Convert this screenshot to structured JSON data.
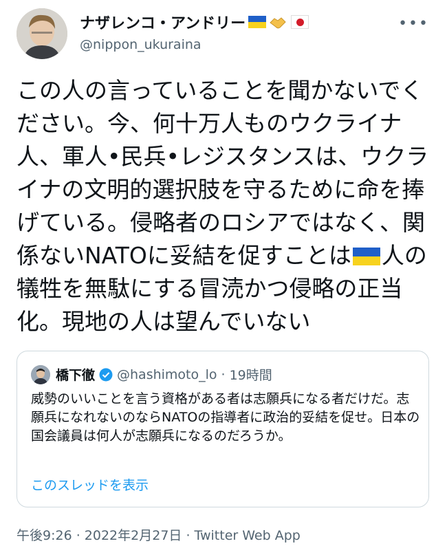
{
  "tweet": {
    "author": {
      "name": "ナザレンコ・アンドリー",
      "handle": "@nippon_ukuraina",
      "name_emojis": [
        "ukraine-flag",
        "handshake",
        "japan-flag"
      ]
    },
    "text_parts": {
      "part1": "この人の言っていることを聞かないでください。今、何十万人ものウクライナ人、軍人•民兵•レジスタンスは、ウクライナの文明的選択肢を守るために命を捧げている。侵略者のロシアではなく、関係ないNATOに妥結を促すことは",
      "part2": "人の犠牲を無駄にする冒涜かつ侵略の正当化。現地の人は望んでいない"
    },
    "inline_emoji": "ukraine-flag",
    "more_icon": "ellipsis-icon",
    "timestamp": "午後9:26 · 2022年2月27日 · Twitter Web App"
  },
  "quote": {
    "name": "橋下徹",
    "verified_icon": "verified-badge-icon",
    "handle": "@hashimoto_lo",
    "separator": "·",
    "time": "19時間",
    "text": "威勢のいいことを言う資格がある者は志願兵になる者だけだ。志願兵になれないのならNATOの指導者に政治的妥結を促せ。日本の国会議員は何人が志願兵になるのだろうか。",
    "link": "このスレッドを表示"
  },
  "colors": {
    "text": "#0f1419",
    "secondary": "#536471",
    "link": "#1d9bf0",
    "border": "#cfd9de",
    "ukraine_blue": "#1f5fc8",
    "ukraine_yellow": "#f7d21e"
  }
}
